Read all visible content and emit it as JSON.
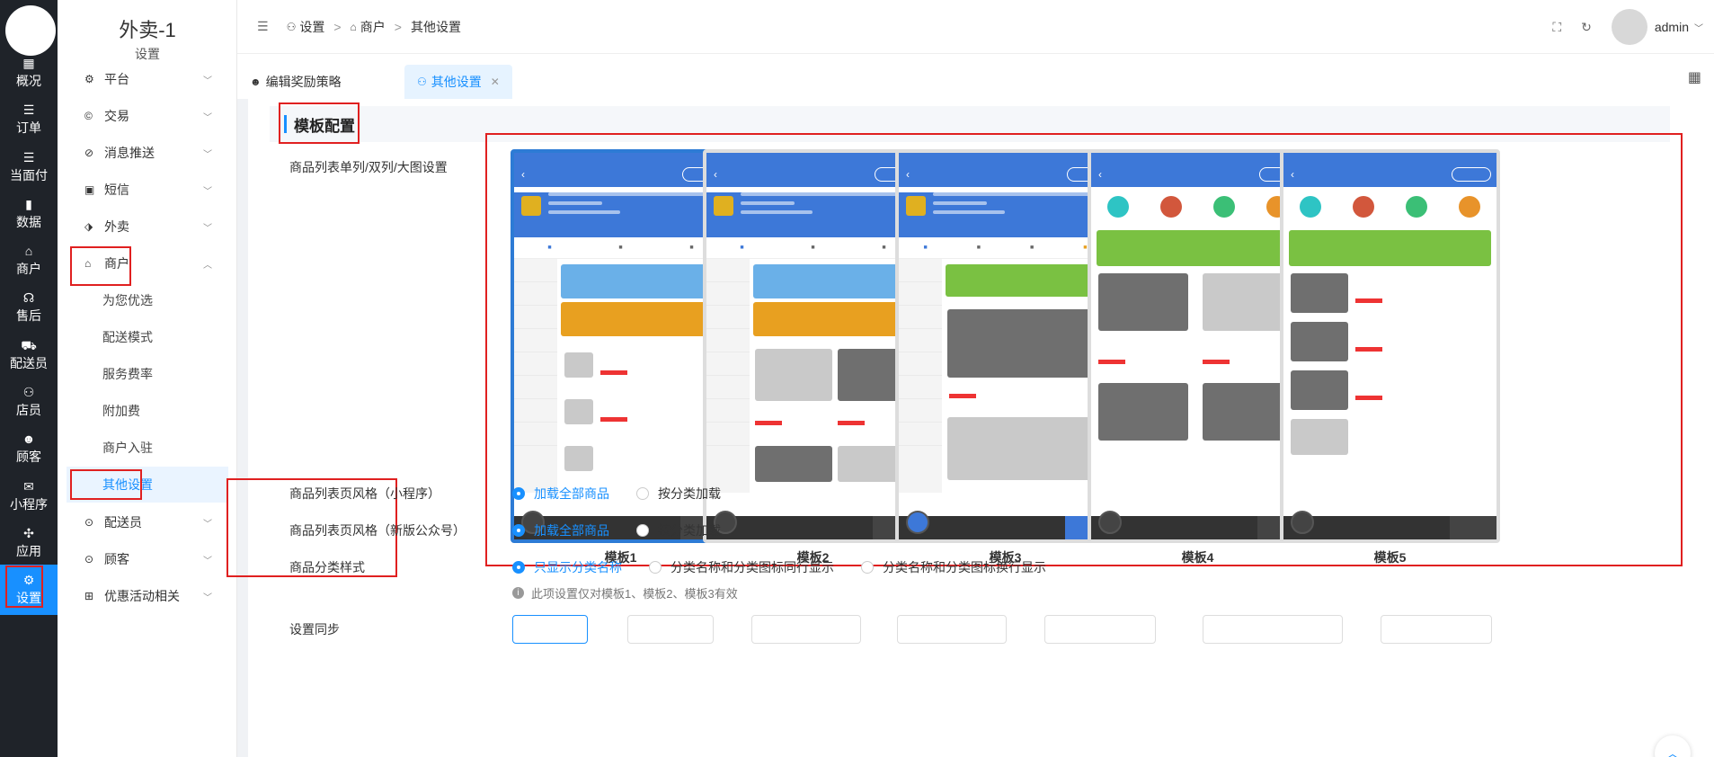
{
  "rail": {
    "items": [
      {
        "label": "概况",
        "icon": "dashboard-icon",
        "glyph": "▦"
      },
      {
        "label": "订单",
        "icon": "list-icon",
        "glyph": "☰"
      },
      {
        "label": "当面付",
        "icon": "list-icon",
        "glyph": "☰"
      },
      {
        "label": "数据",
        "icon": "bar-chart-icon",
        "glyph": "▮"
      },
      {
        "label": "商户",
        "icon": "store-icon",
        "glyph": "⌂"
      },
      {
        "label": "售后",
        "icon": "headset-icon",
        "glyph": "☊"
      },
      {
        "label": "配送员",
        "icon": "scooter-icon",
        "glyph": "⛟"
      },
      {
        "label": "店员",
        "icon": "users-icon",
        "glyph": "⚇"
      },
      {
        "label": "顾客",
        "icon": "user-circle-icon",
        "glyph": "☻"
      },
      {
        "label": "小程序",
        "icon": "wechat-icon",
        "glyph": "✉"
      },
      {
        "label": "应用",
        "icon": "apps-icon",
        "glyph": "✣"
      },
      {
        "label": "设置",
        "icon": "settings-user-icon",
        "glyph": "⚙"
      }
    ]
  },
  "sidebar": {
    "brand": "外卖-1",
    "brand_sub": "设置",
    "menu": [
      {
        "label": "平台",
        "icon": "gear-icon",
        "glyph": "⚙"
      },
      {
        "label": "交易",
        "icon": "copyright-icon",
        "glyph": "©"
      },
      {
        "label": "消息推送",
        "icon": "no-bell-icon",
        "glyph": "⊘"
      },
      {
        "label": "短信",
        "icon": "message-icon",
        "glyph": "▣"
      },
      {
        "label": "外卖",
        "icon": "shield-icon",
        "glyph": "⬗"
      },
      {
        "label": "商户",
        "icon": "shop-icon",
        "glyph": "⌂"
      }
    ],
    "sub": [
      "为您优选",
      "配送模式",
      "服务费率",
      "附加费",
      "商户入驻",
      "其他设置"
    ],
    "menu_bottom": [
      {
        "label": "配送员",
        "icon": "compass-icon",
        "glyph": "⊙"
      },
      {
        "label": "顾客",
        "icon": "compass-icon",
        "glyph": "⊙"
      },
      {
        "label": "优惠活动相关",
        "icon": "gift-icon",
        "glyph": "⊞"
      }
    ]
  },
  "topbar": {
    "breadcrumb": [
      "设置",
      "商户",
      "其他设置"
    ],
    "username": "admin"
  },
  "tabs": [
    {
      "label": "编辑奖励策略"
    },
    {
      "label": "其他设置"
    }
  ],
  "section": {
    "title": "模板配置"
  },
  "form": {
    "list_mode_label": "商品列表单列/双列/大图设置",
    "templates": [
      "模板1",
      "模板2",
      "模板3",
      "模板4",
      "模板5"
    ],
    "selected_template": "模板1",
    "style_mini_label": "商品列表页风格（小程序）",
    "style_mini_options": [
      "加载全部商品",
      "按分类加载"
    ],
    "style_oa_label": "商品列表页风格（新版公众号）",
    "style_oa_options": [
      "加载全部商品",
      "按分类加载"
    ],
    "category_style_label": "商品分类样式",
    "category_style_options": [
      "只显示分类名称",
      "分类名称和分类图标同行显示",
      "分类名称和分类图标换行显示"
    ],
    "hint": "此项设置仅对模板1、模板2、模板3有效",
    "sync_label": "设置同步"
  },
  "colors": {
    "accent": "#1890ff",
    "highlight": "#e02020",
    "rail_bg": "#1f2329"
  }
}
